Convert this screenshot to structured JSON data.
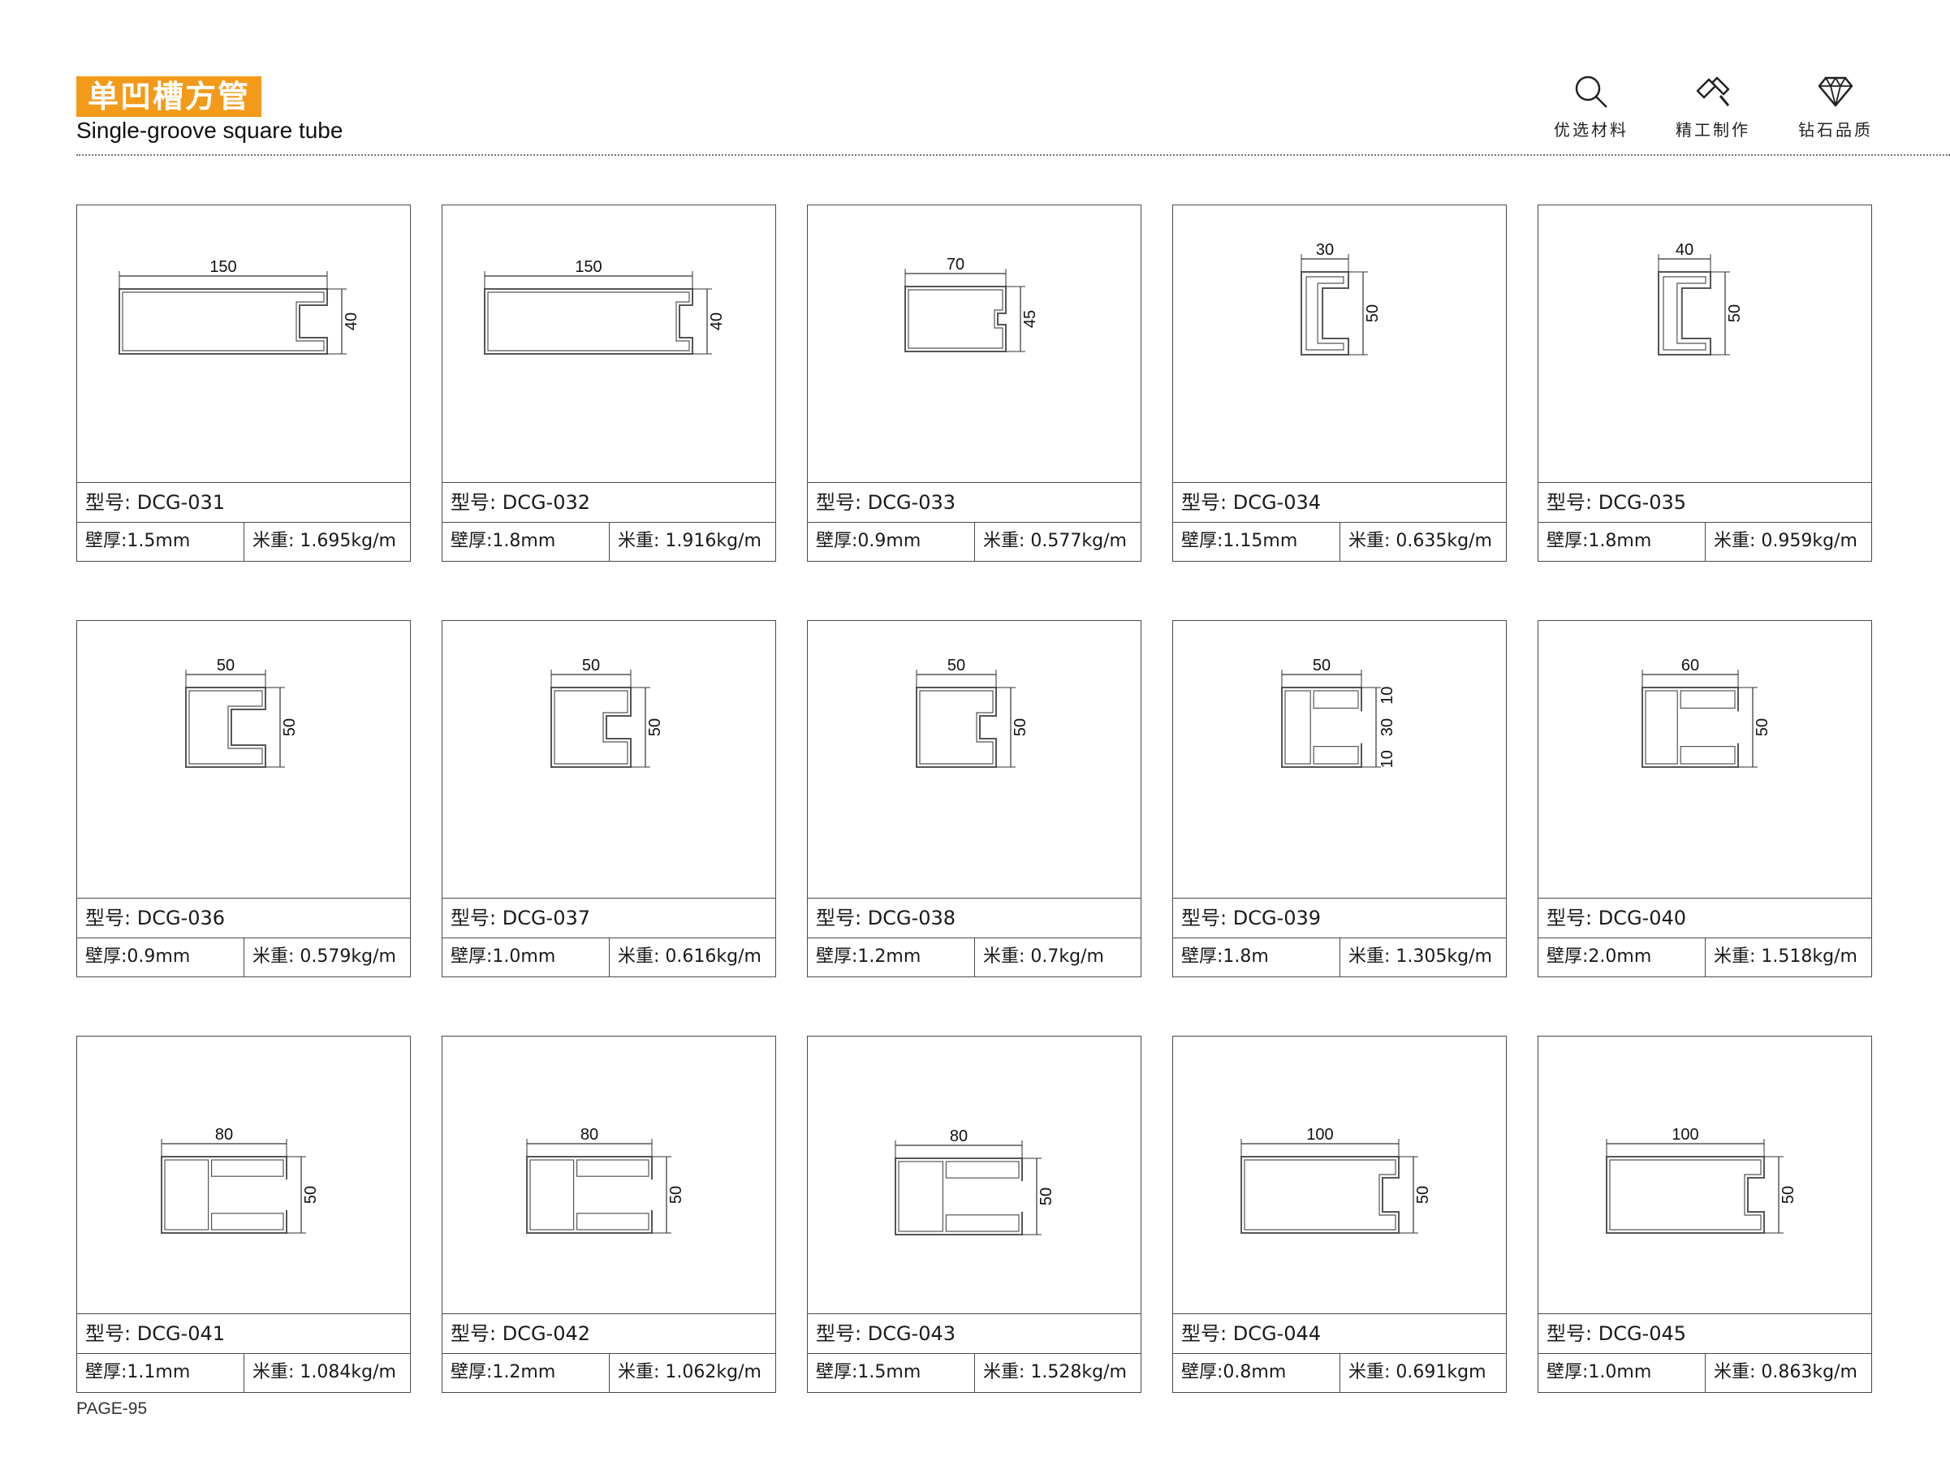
{
  "header": {
    "title_cn": "单凹槽方管",
    "title_en": "Single-groove square tube",
    "accent_color": "#f39a1a"
  },
  "features": [
    {
      "icon": "magnifier-icon",
      "label": "优选材料"
    },
    {
      "icon": "hammer-icon",
      "label": "精工制作"
    },
    {
      "icon": "diamond-icon",
      "label": "钻石品质"
    }
  ],
  "labels": {
    "model_prefix": "型号:",
    "thickness_prefix": "壁厚:",
    "weight_prefix": "米重:"
  },
  "products": [
    {
      "model": "DCG-031",
      "thickness": "1.5mm",
      "weight": "1.695kg/m",
      "width": "150",
      "height": "40"
    },
    {
      "model": "DCG-032",
      "thickness": "1.8mm",
      "weight": "1.916kg/m",
      "width": "150",
      "height": "40"
    },
    {
      "model": "DCG-033",
      "thickness": "0.9mm",
      "weight": "0.577kg/m",
      "width": "70",
      "height": "45"
    },
    {
      "model": "DCG-034",
      "thickness": "1.15mm",
      "weight": "0.635kg/m",
      "width": "30",
      "height": "50"
    },
    {
      "model": "DCG-035",
      "thickness": "1.8mm",
      "weight": "0.959kg/m",
      "width": "40",
      "height": "50"
    },
    {
      "model": "DCG-036",
      "thickness": "0.9mm",
      "weight": "0.579kg/m",
      "width": "50",
      "height": "50"
    },
    {
      "model": "DCG-037",
      "thickness": "1.0mm",
      "weight": "0.616kg/m",
      "width": "50",
      "height": "50"
    },
    {
      "model": "DCG-038",
      "thickness": "1.2mm",
      "weight": "0.7kg/m",
      "width": "50",
      "height": "50"
    },
    {
      "model": "DCG-039",
      "thickness": "1.8m",
      "weight": "1.305kg/m",
      "width": "50",
      "height": "",
      "side_dims": [
        "10",
        "30",
        "10"
      ]
    },
    {
      "model": "DCG-040",
      "thickness": "2.0mm",
      "weight": "1.518kg/m",
      "width": "60",
      "height": "50"
    },
    {
      "model": "DCG-041",
      "thickness": "1.1mm",
      "weight": "1.084kg/m",
      "width": "80",
      "height": "50"
    },
    {
      "model": "DCG-042",
      "thickness": "1.2mm",
      "weight": "1.062kg/m",
      "width": "80",
      "height": "50"
    },
    {
      "model": "DCG-043",
      "thickness": "1.5mm",
      "weight": "1.528kg/m",
      "width": "80",
      "height": "50"
    },
    {
      "model": "DCG-044",
      "thickness": "0.8mm",
      "weight": "0.691kgm",
      "width": "100",
      "height": "50"
    },
    {
      "model": "DCG-045",
      "thickness": "1.0mm",
      "weight": "0.863kg/m",
      "width": "100",
      "height": "50"
    }
  ],
  "footer": {
    "page_label": "PAGE-95"
  }
}
